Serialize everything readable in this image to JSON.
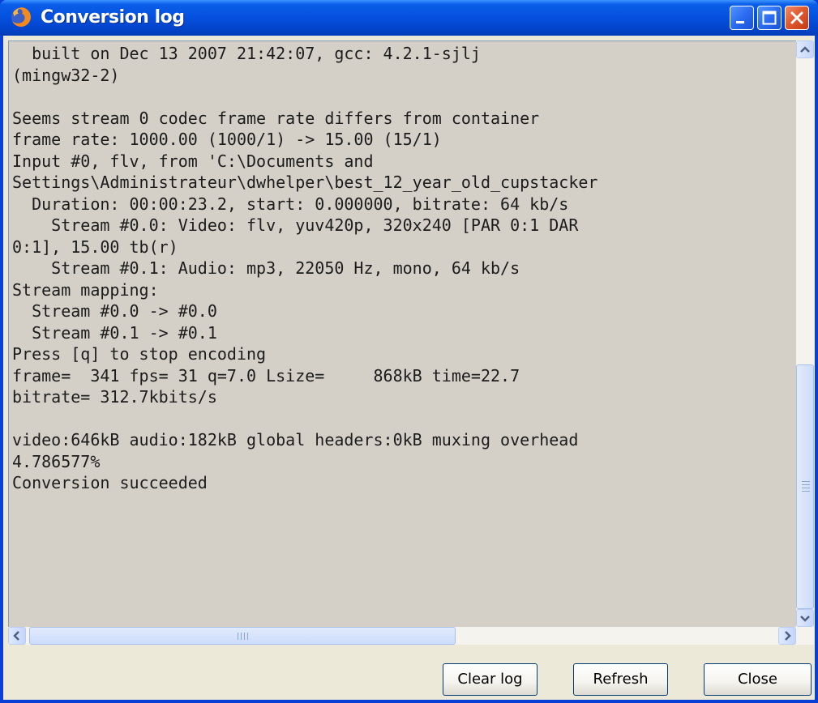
{
  "window": {
    "title": "Conversion log"
  },
  "log": {
    "lines": [
      "  built on Dec 13 2007 21:42:07, gcc: 4.2.1-sjlj",
      "(mingw32-2)",
      "",
      "Seems stream 0 codec frame rate differs from container",
      "frame rate: 1000.00 (1000/1) -> 15.00 (15/1)",
      "Input #0, flv, from 'C:\\Documents and",
      "Settings\\Administrateur\\dwhelper\\best_12_year_old_cupstacker",
      "  Duration: 00:00:23.2, start: 0.000000, bitrate: 64 kb/s",
      "    Stream #0.0: Video: flv, yuv420p, 320x240 [PAR 0:1 DAR",
      "0:1], 15.00 tb(r)",
      "    Stream #0.1: Audio: mp3, 22050 Hz, mono, 64 kb/s",
      "Stream mapping:",
      "  Stream #0.0 -> #0.0",
      "  Stream #0.1 -> #0.1",
      "Press [q] to stop encoding",
      "frame=  341 fps= 31 q=7.0 Lsize=     868kB time=22.7",
      "bitrate= 312.7kbits/s",
      "",
      "video:646kB audio:182kB global headers:0kB muxing overhead",
      "4.786577%",
      "Conversion succeeded"
    ]
  },
  "buttons": {
    "clear_log": "Clear log",
    "refresh": "Refresh",
    "close": "Close"
  },
  "icons": {
    "app": "firefox-icon",
    "minimize": "minimize-icon",
    "maximize": "maximize-icon",
    "close": "close-icon"
  },
  "colors": {
    "titlebar": "#0552e0",
    "close_button": "#e05a30",
    "log_background": "#d4d0c8"
  }
}
